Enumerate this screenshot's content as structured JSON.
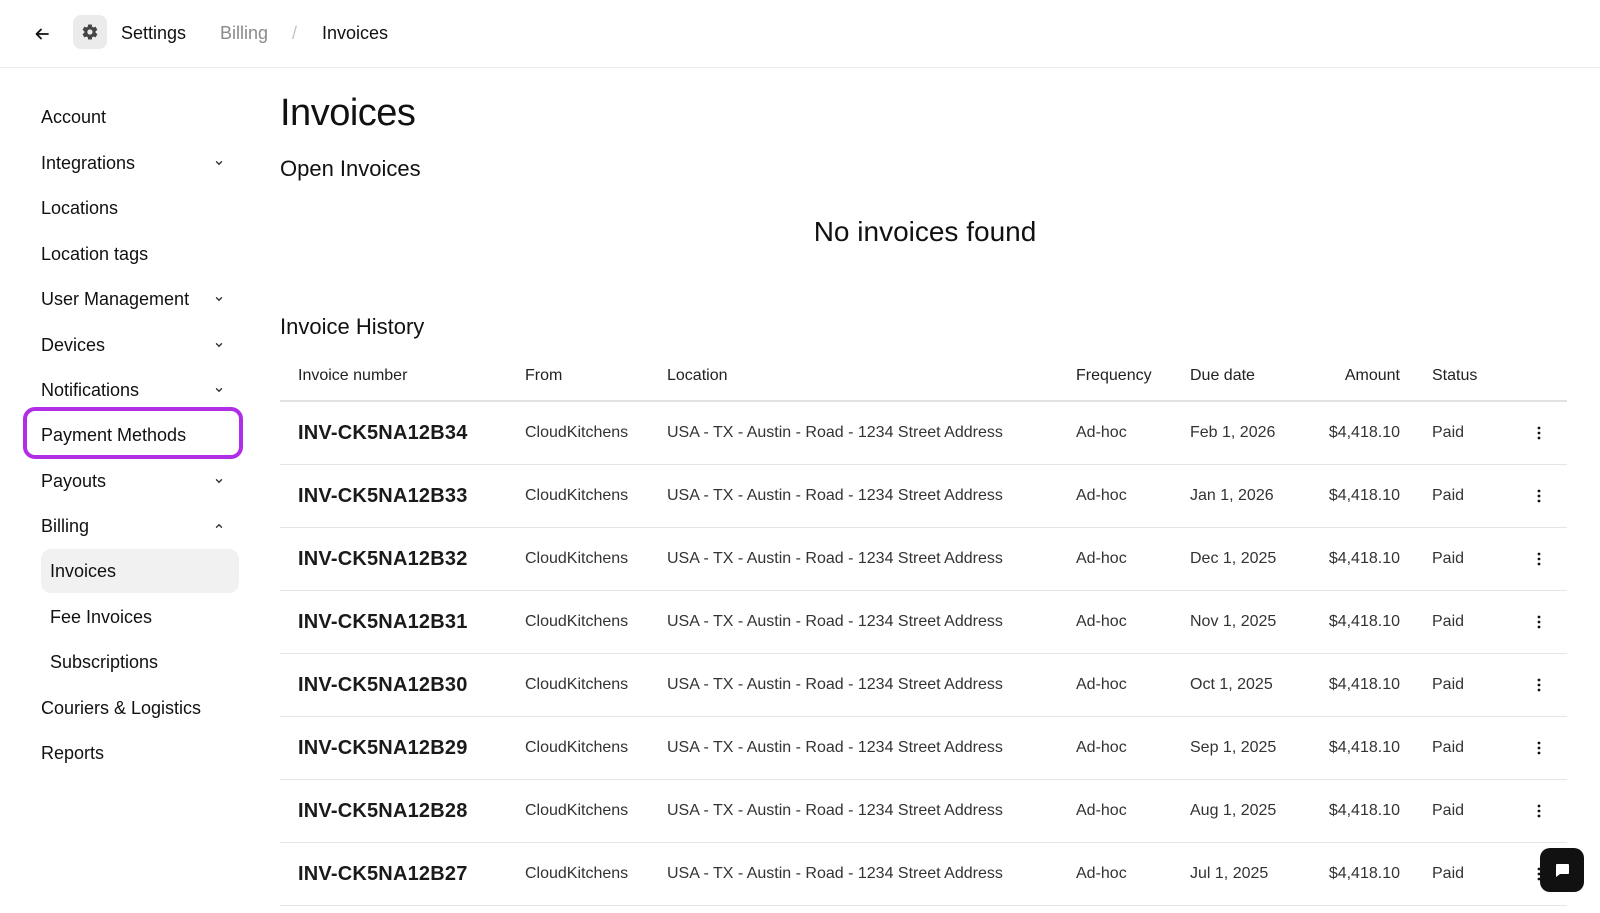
{
  "topbar": {
    "breadcrumb": {
      "root": "Settings",
      "parent": "Billing",
      "separator": "/",
      "current": "Invoices"
    }
  },
  "sidebar": {
    "items": [
      {
        "label": "Account",
        "has_chevron": false
      },
      {
        "label": "Integrations",
        "has_chevron": true,
        "expanded": false
      },
      {
        "label": "Locations",
        "has_chevron": false
      },
      {
        "label": "Location tags",
        "has_chevron": false
      },
      {
        "label": "User Management",
        "has_chevron": true,
        "expanded": false
      },
      {
        "label": "Devices",
        "has_chevron": true,
        "expanded": false
      },
      {
        "label": "Notifications",
        "has_chevron": true,
        "expanded": false
      },
      {
        "label": "Payment Methods",
        "has_chevron": false,
        "highlighted": true
      },
      {
        "label": "Payouts",
        "has_chevron": true,
        "expanded": false
      },
      {
        "label": "Billing",
        "has_chevron": true,
        "expanded": true
      },
      {
        "label": "Couriers & Logistics",
        "has_chevron": false
      },
      {
        "label": "Reports",
        "has_chevron": false
      }
    ],
    "billing_children": [
      {
        "label": "Invoices",
        "active": true
      },
      {
        "label": "Fee Invoices",
        "active": false
      },
      {
        "label": "Subscriptions",
        "active": false
      }
    ],
    "highlight_color": "#b02ee6"
  },
  "main": {
    "title": "Invoices",
    "open_section": {
      "title": "Open Invoices",
      "empty_message": "No invoices found"
    },
    "history_section": {
      "title": "Invoice History",
      "columns": [
        "Invoice number",
        "From",
        "Location",
        "Frequency",
        "Due date",
        "Amount",
        "Status"
      ],
      "rows": [
        {
          "invoice": "INV-CK5NA12B34",
          "from": "CloudKitchens",
          "location": "USA - TX - Austin - Road - 1234 Street Address",
          "frequency": "Ad-hoc",
          "due": "Feb 1, 2026",
          "amount": "$4,418.10",
          "status": "Paid"
        },
        {
          "invoice": "INV-CK5NA12B33",
          "from": "CloudKitchens",
          "location": "USA - TX - Austin - Road - 1234 Street Address",
          "frequency": "Ad-hoc",
          "due": "Jan 1, 2026",
          "amount": "$4,418.10",
          "status": "Paid"
        },
        {
          "invoice": "INV-CK5NA12B32",
          "from": "CloudKitchens",
          "location": "USA - TX - Austin - Road - 1234 Street Address",
          "frequency": "Ad-hoc",
          "due": "Dec 1, 2025",
          "amount": "$4,418.10",
          "status": "Paid"
        },
        {
          "invoice": "INV-CK5NA12B31",
          "from": "CloudKitchens",
          "location": "USA - TX - Austin - Road - 1234 Street Address",
          "frequency": "Ad-hoc",
          "due": "Nov 1, 2025",
          "amount": "$4,418.10",
          "status": "Paid"
        },
        {
          "invoice": "INV-CK5NA12B30",
          "from": "CloudKitchens",
          "location": "USA - TX - Austin - Road - 1234 Street Address",
          "frequency": "Ad-hoc",
          "due": "Oct 1, 2025",
          "amount": "$4,418.10",
          "status": "Paid"
        },
        {
          "invoice": "INV-CK5NA12B29",
          "from": "CloudKitchens",
          "location": "USA - TX - Austin - Road - 1234 Street Address",
          "frequency": "Ad-hoc",
          "due": "Sep 1, 2025",
          "amount": "$4,418.10",
          "status": "Paid"
        },
        {
          "invoice": "INV-CK5NA12B28",
          "from": "CloudKitchens",
          "location": "USA - TX - Austin - Road - 1234 Street Address",
          "frequency": "Ad-hoc",
          "due": "Aug 1, 2025",
          "amount": "$4,418.10",
          "status": "Paid"
        },
        {
          "invoice": "INV-CK5NA12B27",
          "from": "CloudKitchens",
          "location": "USA - TX - Austin - Road - 1234 Street Address",
          "frequency": "Ad-hoc",
          "due": "Jul 1, 2025",
          "amount": "$4,418.10",
          "status": "Paid"
        }
      ]
    }
  },
  "icons": {
    "back": "arrow-left-icon",
    "settings": "gear-icon",
    "chevron_collapsed": "chevron-down-icon",
    "chevron_expanded": "chevron-up-icon",
    "row_menu": "more-vertical-icon",
    "chat": "chat-bubble-icon"
  }
}
